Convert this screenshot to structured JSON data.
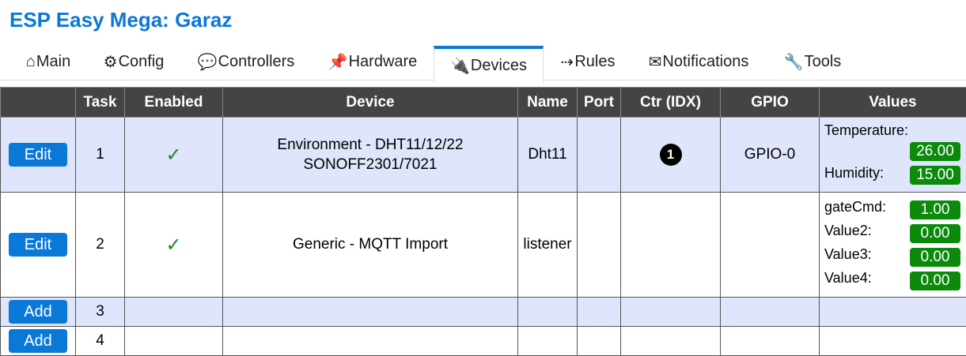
{
  "header": {
    "title": "ESP Easy Mega: Garaz"
  },
  "menu": {
    "tabs": [
      {
        "glyph": "⌂",
        "icon": "home-icon",
        "label": "Main"
      },
      {
        "glyph": "⚙",
        "icon": "gear-icon",
        "label": "Config"
      },
      {
        "glyph": "💬",
        "icon": "chat-icon",
        "label": "Controllers"
      },
      {
        "glyph": "📌",
        "icon": "pin-icon",
        "label": "Hardware"
      },
      {
        "glyph": "🔌",
        "icon": "plug-icon",
        "label": "Devices",
        "active": true
      },
      {
        "glyph": "⇢",
        "icon": "arrow-icon",
        "label": "Rules"
      },
      {
        "glyph": "✉",
        "icon": "envelope-icon",
        "label": "Notifications"
      },
      {
        "glyph": "🔧",
        "icon": "wrench-icon",
        "label": "Tools"
      }
    ]
  },
  "table": {
    "headers": [
      "",
      "Task",
      "Enabled",
      "Device",
      "Name",
      "Port",
      "Ctr (IDX)",
      "GPIO",
      "Values"
    ],
    "rows": [
      {
        "button": "Edit",
        "task": "1",
        "enabled": "✓",
        "device_line1": "Environment - DHT11/12/22",
        "device_line2": "SONOFF2301/7021",
        "name": "Dht11",
        "port": "",
        "ctr": "❶",
        "gpio": "GPIO-0",
        "values": [
          {
            "label": "Temperature:",
            "value": "26.00"
          },
          {
            "label": "Humidity:",
            "value": "15.00"
          }
        ]
      },
      {
        "button": "Edit",
        "task": "2",
        "enabled": "✓",
        "device_line1": "Generic - MQTT Import",
        "device_line2": "",
        "name": "listener",
        "port": "",
        "ctr": "",
        "gpio": "",
        "values": [
          {
            "label": "gateCmd:",
            "value": "1.00"
          },
          {
            "label": "Value2:",
            "value": "0.00"
          },
          {
            "label": "Value3:",
            "value": "0.00"
          },
          {
            "label": "Value4:",
            "value": "0.00"
          }
        ]
      },
      {
        "button": "Add",
        "task": "3"
      },
      {
        "button": "Add",
        "task": "4"
      }
    ]
  },
  "colors": {
    "accent": "#0a78d7",
    "value_badge": "#0b8a0b",
    "header_bg": "#444444",
    "row_alt": "#dfe5fa"
  }
}
